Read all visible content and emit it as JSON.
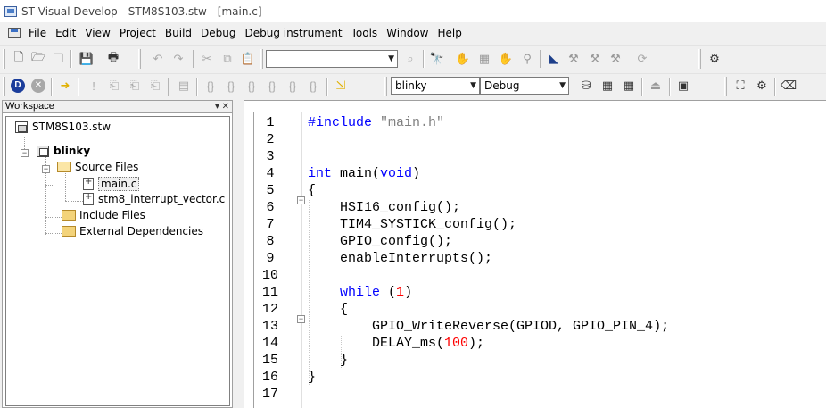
{
  "window": {
    "title": "ST Visual Develop - STM8S103.stw - [main.c]"
  },
  "menubar": {
    "items": [
      "File",
      "Edit",
      "View",
      "Project",
      "Build",
      "Debug",
      "Debug instrument",
      "Tools",
      "Window",
      "Help"
    ]
  },
  "toolbar": {
    "find_combo_value": "",
    "project_combo_value": "blinky",
    "config_combo_value": "Debug",
    "icons_row1": [
      "new-file-icon",
      "open-folder-icon",
      "open-workspace-icon",
      "save-icon",
      "print-icon",
      "undo-icon",
      "redo-icon",
      "cut-icon",
      "copy-icon",
      "paste-icon",
      "find-in-files-icon",
      "find-icon",
      "hand-icon",
      "bookmark-icon",
      "toggle-breakpoint-icon",
      "clear-breakpoints-icon",
      "brace-match-icon",
      "compile-icon",
      "build-icon",
      "rebuild-icon",
      "stop-build-icon",
      "refresh-icon",
      "options-icon"
    ],
    "icons_row2": [
      "debug-start-icon",
      "debug-stop-icon",
      "run-arrow-icon",
      "break-icon",
      "step-into-icon",
      "step-over-icon",
      "step-out-icon",
      "run-to-cursor-icon",
      "step-asm-icon",
      "step-over-asm-icon",
      "step-out-asm-icon",
      "brace-step-icon",
      "reset-icon",
      "memory-icon",
      "registers-icon",
      "watch-icon",
      "peripherals-icon",
      "disassembly-icon",
      "programmer-icon",
      "settings-icon",
      "chip-icon"
    ]
  },
  "workspace": {
    "header": "Workspace",
    "tree": {
      "root": "STM8S103.stw",
      "project": "blinky",
      "source_folder": "Source Files",
      "source_files": [
        "main.c",
        "stm8_interrupt_vector.c"
      ],
      "include_folder": "Include Files",
      "external_folder": "External Dependencies"
    }
  },
  "editor": {
    "line_numbers": [
      "1",
      "2",
      "3",
      "4",
      "5",
      "6",
      "7",
      "8",
      "9",
      "10",
      "11",
      "12",
      "13",
      "14",
      "15",
      "16",
      "17"
    ],
    "code": {
      "l1_directive": "#include",
      "l1_string": "\"main.h\"",
      "l4_type": "int",
      "l4_rest": " main(",
      "l4_void": "void",
      "l4_close": ")",
      "l5": "{",
      "l6": "    HSI16_config();",
      "l7": "    TIM4_SYSTICK_config();",
      "l8": "    GPIO_config();",
      "l9": "    enableInterrupts();",
      "l11_kw": "while",
      "l11_open": " (",
      "l11_num": "1",
      "l11_close": ")",
      "l12": "    {",
      "l13": "        GPIO_WriteReverse(GPIOD, GPIO_PIN_4);",
      "l14_pre": "        DELAY_ms(",
      "l14_num": "100",
      "l14_post": ");",
      "l15": "    }",
      "l16": "}"
    }
  },
  "colors": {
    "keyword": "#0000ff",
    "number": "#ff0000",
    "string": "#808080"
  }
}
